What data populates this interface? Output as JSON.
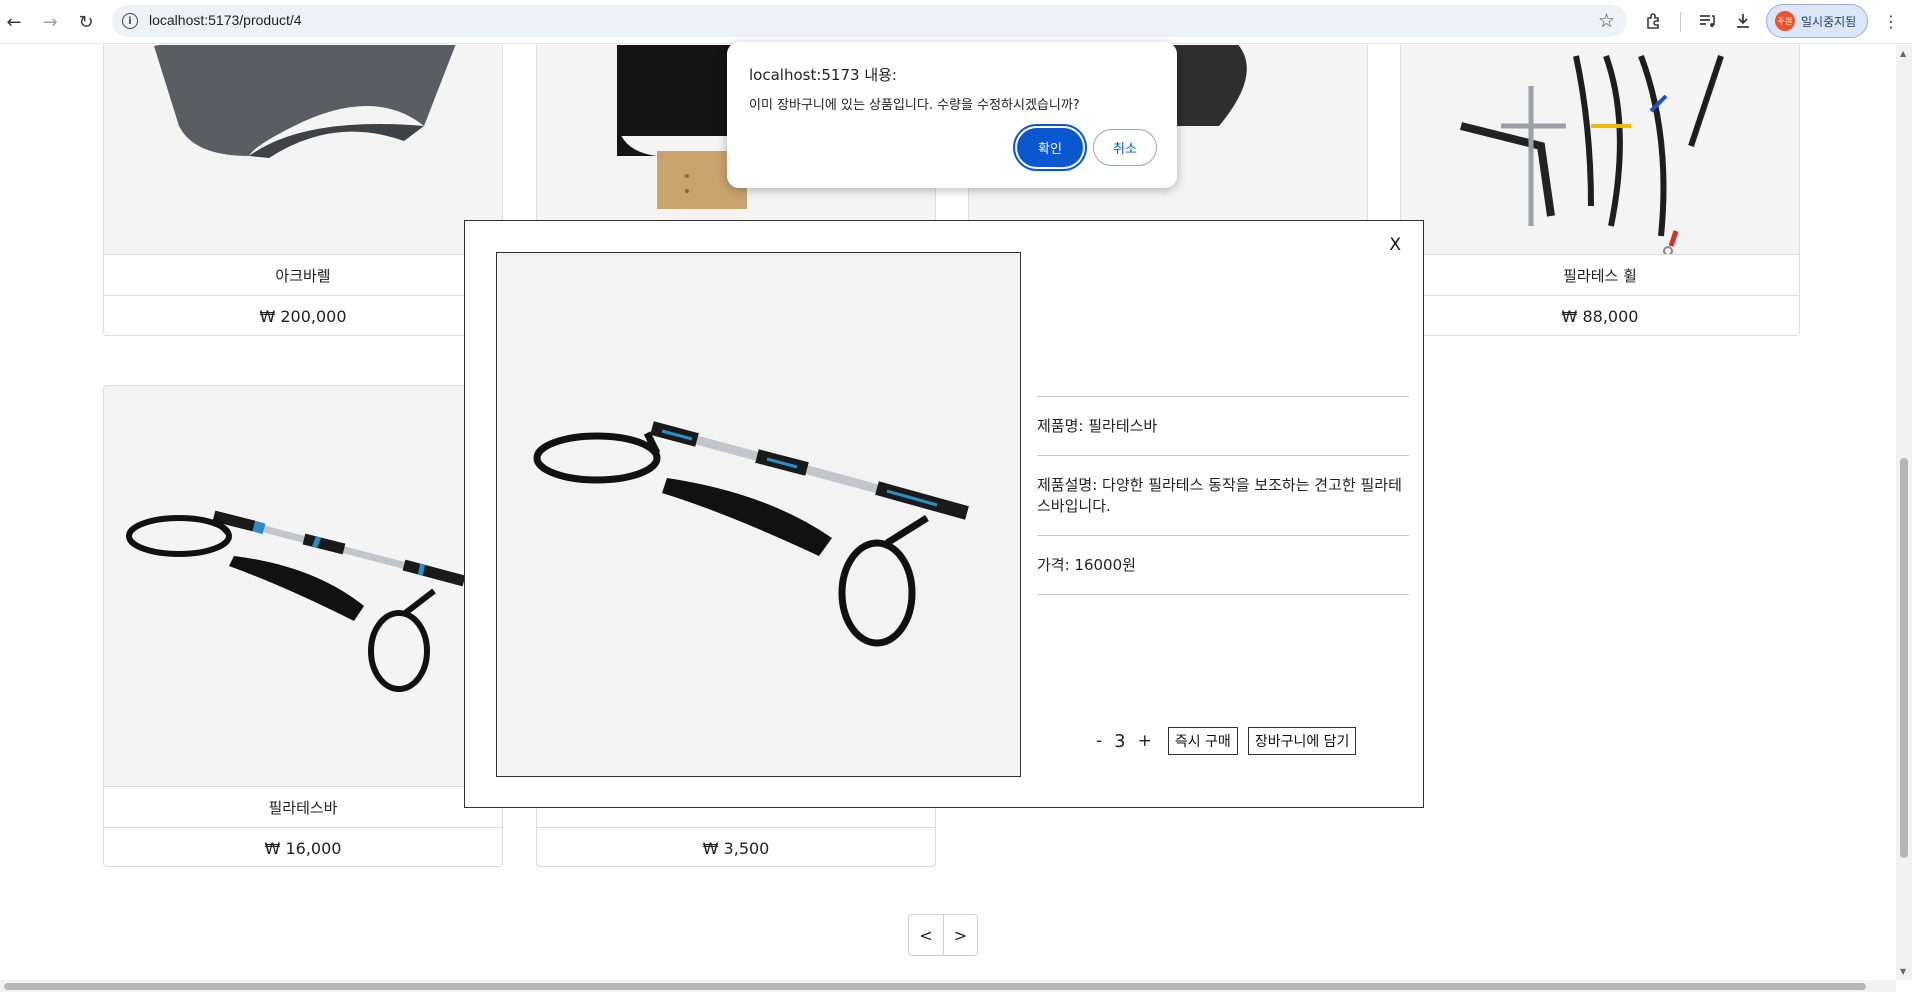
{
  "browser": {
    "url": "localhost:5173/product/4",
    "profile_label": "일시중지됨",
    "profile_avatar": "주원"
  },
  "products": [
    {
      "name": "아크바렐",
      "price": "₩ 200,000",
      "image": "arc-barrel"
    },
    {
      "name": "",
      "price": "",
      "image": "reformer-box"
    },
    {
      "name": "",
      "price": "",
      "image": "mat"
    },
    {
      "name": "필라테스 휠",
      "price": "₩ 88,000",
      "image": "pilates-wheel-straps"
    },
    {
      "name": "필라테스바",
      "price": "₩ 16,000",
      "image": "pilates-bar"
    },
    {
      "name": "",
      "price": "₩ 3,500",
      "image": "hidden"
    }
  ],
  "pagination": {
    "prev": "<",
    "next": ">"
  },
  "modal": {
    "close": "X",
    "product_name_row": "제품명: 필라테스바",
    "description_row": "제품설명: 다양한 필라테스 동작을 보조하는 견고한 필라테스바입니다.",
    "price_row": "가격: 16000원",
    "qty_minus": "-",
    "qty_value": "3",
    "qty_plus": "+",
    "buy_now": "즉시 구매",
    "add_cart": "장바구니에 담기"
  },
  "dialog": {
    "title": "localhost:5173 내용:",
    "message": "이미 장바구니에 있는 상품입니다. 수량을 수정하시겠습니까?",
    "ok": "확인",
    "cancel": "취소"
  },
  "colors": {
    "dialog_ok": "#0b57d0",
    "profile_avatar": "#e8532f"
  }
}
